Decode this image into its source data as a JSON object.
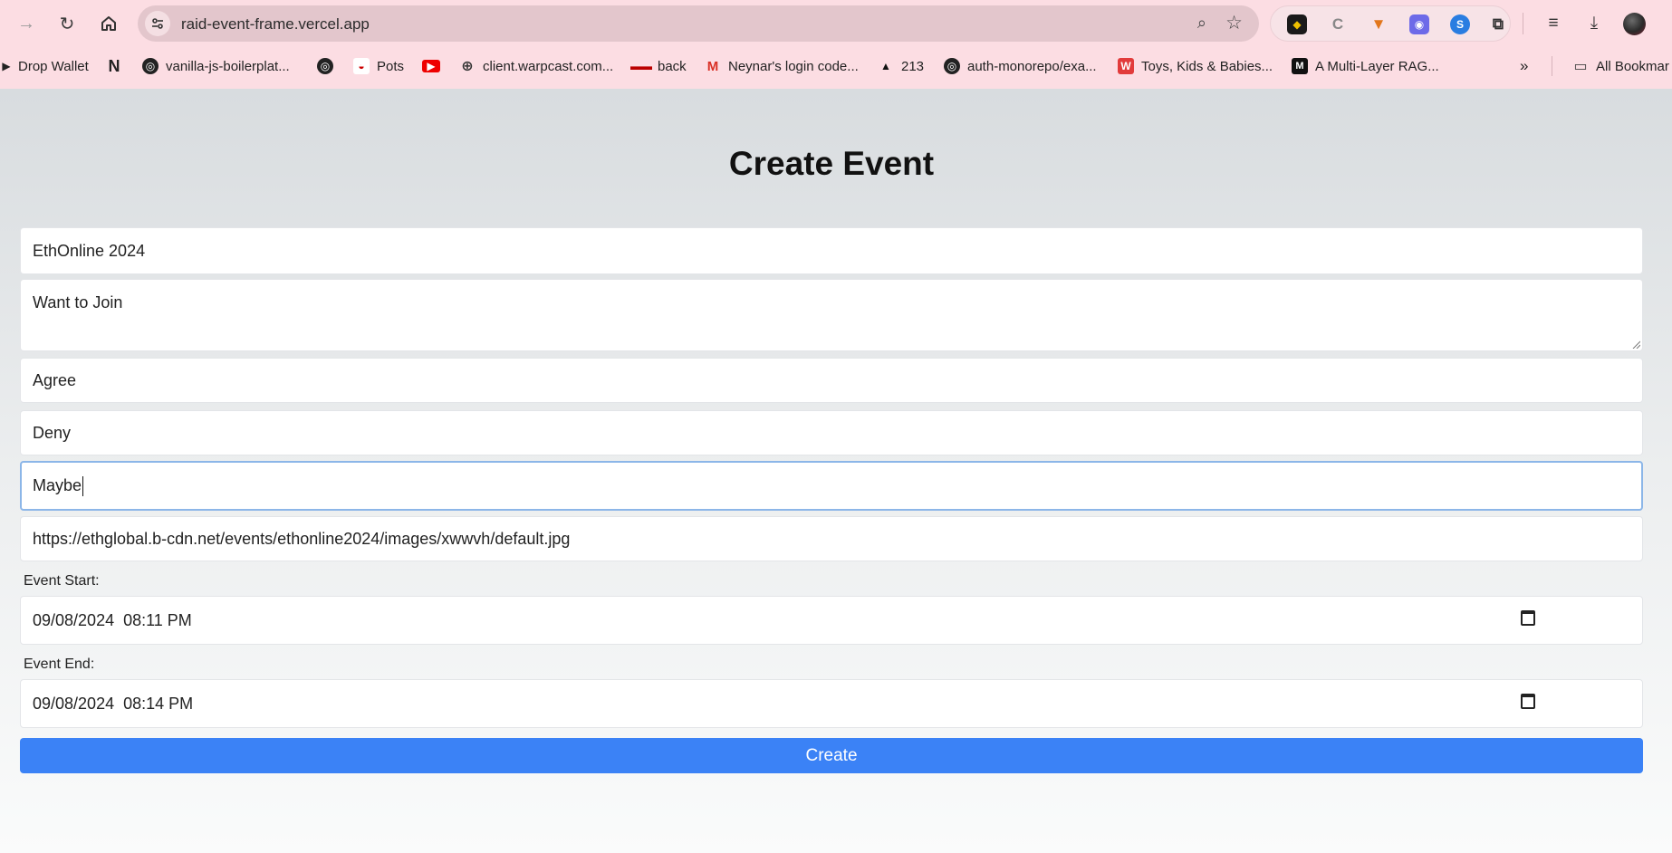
{
  "browser": {
    "url": "raid-event-frame.vercel.app",
    "bookmarks": [
      {
        "label": "Drop Wallet",
        "icon": "play-icon"
      },
      {
        "label": "",
        "icon": "n-logo-icon"
      },
      {
        "label": "vanilla-js-boilerplat...",
        "icon": "github-icon"
      },
      {
        "label": "",
        "icon": "github-icon"
      },
      {
        "label": "Pots",
        "icon": "pots-icon"
      },
      {
        "label": "",
        "icon": "youtube-icon"
      },
      {
        "label": "client.warpcast.com...",
        "icon": "globe-icon"
      },
      {
        "label": "back",
        "icon": "glasses-icon"
      },
      {
        "label": "Neynar's login code...",
        "icon": "gmail-icon"
      },
      {
        "label": "213",
        "icon": "triangle-icon"
      },
      {
        "label": "auth-monorepo/exa...",
        "icon": "github-icon"
      },
      {
        "label": "Toys, Kids & Babies...",
        "icon": "store-icon"
      },
      {
        "label": "A Multi-Layer RAG...",
        "icon": "medium-icon"
      }
    ],
    "all_bookmarks": "All Bookmar"
  },
  "page": {
    "title": "Create Event",
    "fields": {
      "name": "EthOnline 2024",
      "description": "Want to Join",
      "option1": "Agree",
      "option2": "Deny",
      "option3": "Maybe",
      "image_url": "https://ethglobal.b-cdn.net/events/ethonline2024/images/xwwvh/default.jpg"
    },
    "event_start_label": "Event Start:",
    "event_start_value": "09/08/2024  08:11 PM",
    "event_end_label": "Event End:",
    "event_end_value": "09/08/2024  08:14 PM",
    "create_label": "Create"
  },
  "colors": {
    "chrome": "#fcdde3",
    "button": "#3b82f6",
    "focus": "#8cb6e8"
  }
}
